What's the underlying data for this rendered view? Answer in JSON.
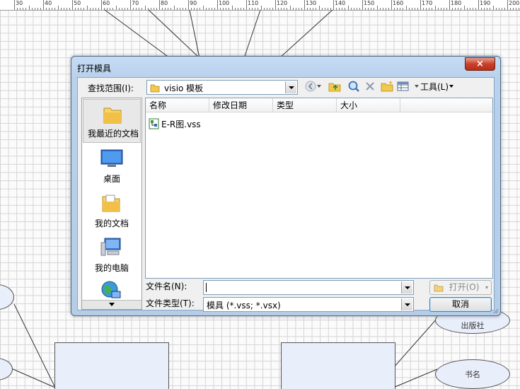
{
  "ruler": {
    "labels": [
      "30",
      "40",
      "50",
      "60",
      "70",
      "80",
      "90",
      "100",
      "110",
      "120",
      "130",
      "140",
      "150",
      "160",
      "170",
      "180",
      "190",
      "200"
    ]
  },
  "canvas": {
    "oval_right_1": "出版社",
    "oval_right_2": "书名"
  },
  "dialog": {
    "title": "打开模具",
    "close_label": "×",
    "lookin_label": "查找范围(I):",
    "lookin_value": "visio 模板",
    "tools_label": "工具(L)",
    "places": [
      {
        "label": "我最近的文档",
        "icon": "recent-folder-icon"
      },
      {
        "label": "桌面",
        "icon": "desktop-icon"
      },
      {
        "label": "我的文档",
        "icon": "documents-folder-icon"
      },
      {
        "label": "我的电脑",
        "icon": "computer-icon"
      }
    ],
    "columns": [
      "名称",
      "修改日期",
      "类型",
      "大小"
    ],
    "files": [
      {
        "name": "E-R图.vss"
      }
    ],
    "filename_label": "文件名(N):",
    "filename_value": "",
    "filetype_label": "文件类型(T):",
    "filetype_value": "模具 (*.vss; *.vsx)",
    "open_label": "打开(O)",
    "cancel_label": "取消"
  }
}
